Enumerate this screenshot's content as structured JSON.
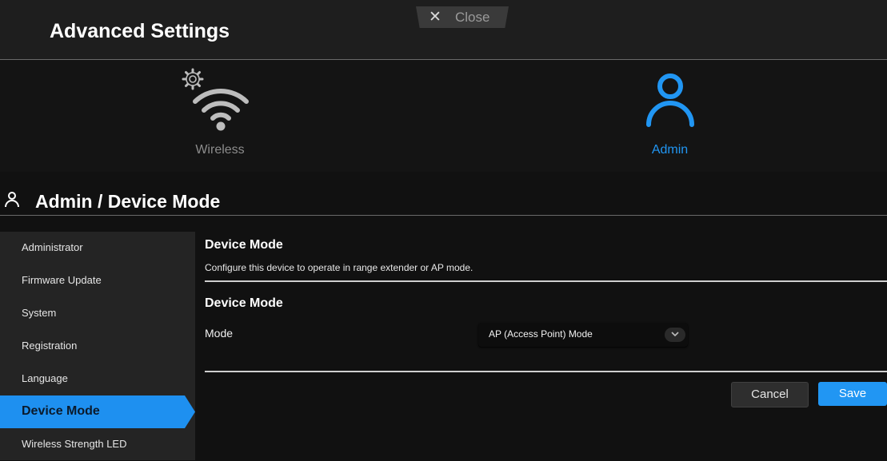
{
  "header": {
    "title": "Advanced Settings",
    "close_label": "Close",
    "close_icon": "close-icon"
  },
  "categories": [
    {
      "label": "Wireless",
      "icon": "wifi-settings-icon",
      "active": false
    },
    {
      "label": "Admin",
      "icon": "person-icon",
      "active": true
    }
  ],
  "page": {
    "title": "Admin / Device Mode",
    "icon": "person-icon"
  },
  "sidebar": {
    "items": [
      {
        "label": "Administrator"
      },
      {
        "label": "Firmware Update"
      },
      {
        "label": "System"
      },
      {
        "label": "Registration"
      },
      {
        "label": "Language"
      },
      {
        "label": "Device Mode",
        "active": true
      },
      {
        "label": "Wireless Strength LED"
      }
    ]
  },
  "main": {
    "section_title": "Device Mode",
    "section_description": "Configure this device to operate in range extender or AP mode.",
    "subsection_title": "Device Mode",
    "mode_label": "Mode",
    "mode_value": "AP (Access Point) Mode",
    "cancel_label": "Cancel",
    "save_label": "Save"
  },
  "colors": {
    "accent": "#2196f3",
    "background": "#111111",
    "sidebar": "#242424"
  }
}
